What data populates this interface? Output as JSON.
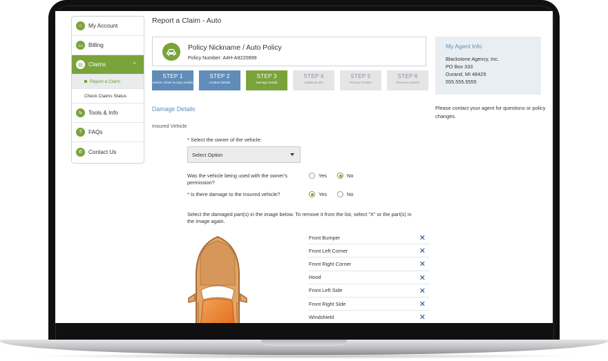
{
  "sidebar": {
    "items": [
      {
        "label": "My Account"
      },
      {
        "label": "Billing"
      },
      {
        "label": "Claims"
      },
      {
        "label": "Tools & Info"
      },
      {
        "label": "FAQs"
      },
      {
        "label": "Contact Us"
      }
    ],
    "subitems": [
      {
        "label": "Report a Claim"
      },
      {
        "label": "Check Claims Status"
      }
    ]
  },
  "page": {
    "title": "Report a Claim - Auto"
  },
  "policy": {
    "name": "Policy Nickname / Auto Policy",
    "number": "Policy Number: A4H-A9220899"
  },
  "steps": [
    {
      "num": "STEP 1",
      "desc": "Vehicle, Driver & Injury Details",
      "state": "done"
    },
    {
      "num": "STEP 2",
      "desc": "Incident Details",
      "state": "done"
    },
    {
      "num": "STEP 3",
      "desc": "Damage Details",
      "state": "current"
    },
    {
      "num": "STEP 4",
      "desc": "Additional Info",
      "state": "todo"
    },
    {
      "num": "STEP 5",
      "desc": "Primary Contact",
      "state": "todo"
    },
    {
      "num": "STEP 6",
      "desc": "Review & Submit",
      "state": "todo"
    }
  ],
  "agent": {
    "title": "My Agent Info",
    "lines": [
      "Blackstone Agency, Inc.",
      "PO Box 333",
      "Durand, MI 48429",
      "555.555.5555"
    ],
    "note": "Please contact your agent for questions or policy changes."
  },
  "form": {
    "section_title": "Damage Details",
    "section_sub": "Insured Vehicle",
    "owner_question": "* Select the owner of the vehicle:",
    "owner_select": "Select Option",
    "permission_question": "Was the vehicle being used with the owner's permission?",
    "permission_yes": "Yes",
    "permission_no": "No",
    "damage_question": "* Is there damage to the insured vehicle?",
    "damage_yes": "Yes",
    "damage_no": "No",
    "instructions": "Select the damaged part(s) in the image below. To remove it from the list, select \"X\" or the part(s) in the image again."
  },
  "parts": [
    {
      "label": "Front Bumper"
    },
    {
      "label": "Front Left Corner"
    },
    {
      "label": "Front Right Corner"
    },
    {
      "label": "Hood"
    },
    {
      "label": "Front Left Side"
    },
    {
      "label": "Front Right Side"
    },
    {
      "label": "Windshield"
    }
  ],
  "colors": {
    "accent": "#7aa33b",
    "blue": "#5f8db8",
    "damage": "#e8832e"
  }
}
